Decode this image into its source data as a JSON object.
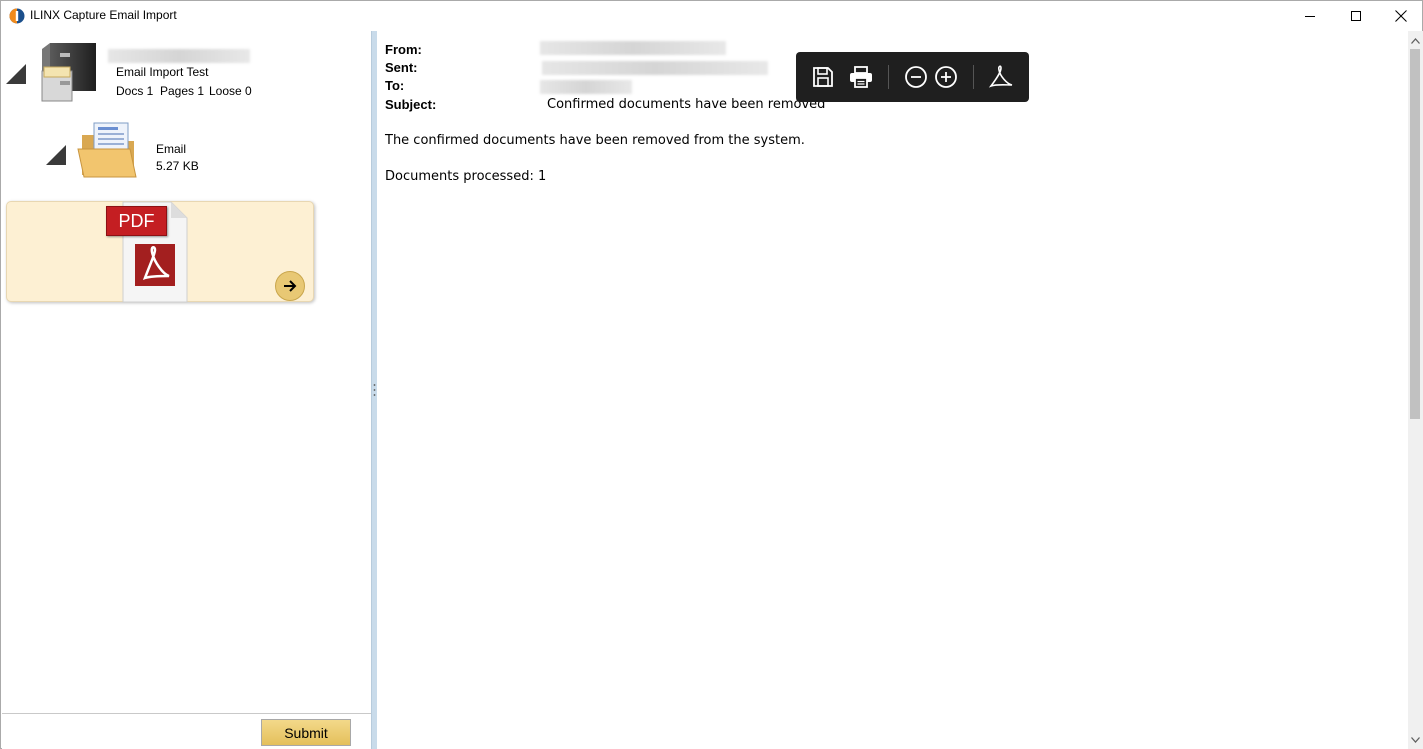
{
  "window": {
    "title": "ILINX Capture Email Import",
    "minimize_icon": "minimize-icon",
    "maximize_icon": "maximize-icon",
    "close_icon": "close-icon"
  },
  "tree": {
    "batch": {
      "icon": "file-cabinet-icon",
      "name": "Email Import Test",
      "docs": "Docs 1",
      "pages": "Pages 1",
      "loose": "Loose 0"
    },
    "email": {
      "icon": "email-folder-icon",
      "label": "Email",
      "size": "5.27 KB"
    },
    "pdf": {
      "badge": "PDF",
      "icon": "pdf-document-icon",
      "action_icon": "arrow-right-icon"
    }
  },
  "footer": {
    "submit_label": "Submit"
  },
  "email_view": {
    "from_label": "From:",
    "sent_label": "Sent:",
    "to_label": "To:",
    "subject_label": "Subject:",
    "subject_value": "Confirmed documents have been removed",
    "body_line1": "The confirmed documents have been removed from the system.",
    "body_line2": "Documents processed: 1"
  },
  "viewer_toolbar": {
    "buttons": [
      "save-icon",
      "print-icon",
      "zoom-out-icon",
      "zoom-in-icon",
      "adobe-acrobat-icon"
    ]
  },
  "colors": {
    "selected_card": "#fdf0d3",
    "toolbar_bg": "#1f1f1f",
    "submit_bg": "#e4c05b",
    "splitter": "#c9dbea"
  }
}
